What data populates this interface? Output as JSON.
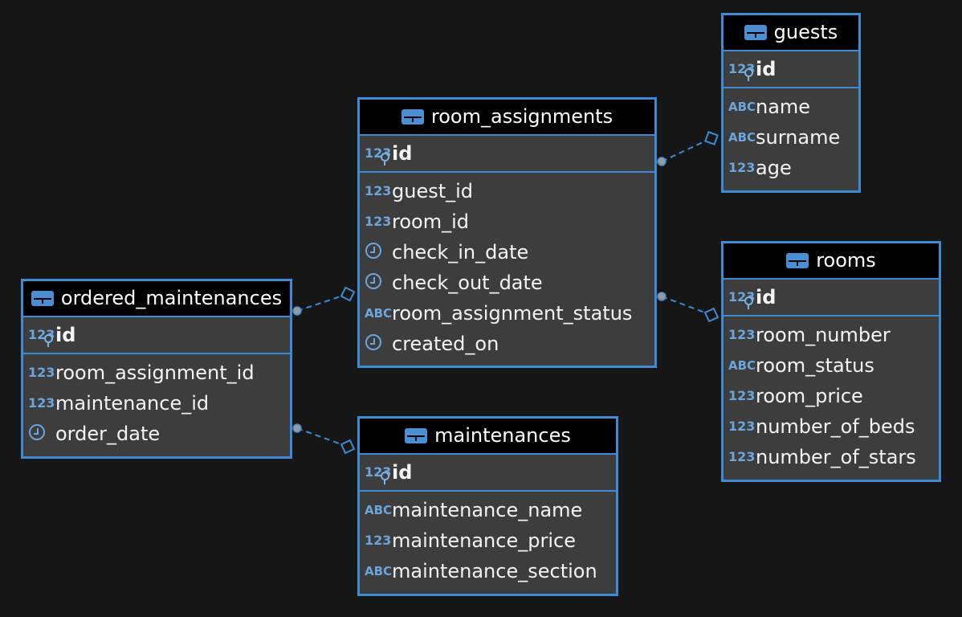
{
  "tables": [
    {
      "key": "room_assignments",
      "name": "room_assignments",
      "pk": {
        "name": "id",
        "type": "123"
      },
      "columns": [
        {
          "name": "guest_id",
          "type": "123"
        },
        {
          "name": "room_id",
          "type": "123"
        },
        {
          "name": "check_in_date",
          "type": "clock"
        },
        {
          "name": "check_out_date",
          "type": "clock"
        },
        {
          "name": "room_assignment_status",
          "type": "ABC"
        },
        {
          "name": "created_on",
          "type": "clock"
        }
      ]
    },
    {
      "key": "guests",
      "name": "guests",
      "pk": {
        "name": "id",
        "type": "123"
      },
      "columns": [
        {
          "name": "name",
          "type": "ABC"
        },
        {
          "name": "surname",
          "type": "ABC"
        },
        {
          "name": "age",
          "type": "123"
        }
      ]
    },
    {
      "key": "rooms",
      "name": "rooms",
      "pk": {
        "name": "id",
        "type": "123"
      },
      "columns": [
        {
          "name": "room_number",
          "type": "123"
        },
        {
          "name": "room_status",
          "type": "ABC"
        },
        {
          "name": "room_price",
          "type": "123"
        },
        {
          "name": "number_of_beds",
          "type": "123"
        },
        {
          "name": "number_of_stars",
          "type": "123"
        }
      ]
    },
    {
      "key": "ordered_maintenances",
      "name": "ordered_maintenances",
      "pk": {
        "name": "id",
        "type": "123"
      },
      "columns": [
        {
          "name": "room_assignment_id",
          "type": "123"
        },
        {
          "name": "maintenance_id",
          "type": "123"
        },
        {
          "name": "order_date",
          "type": "clock"
        }
      ]
    },
    {
      "key": "maintenances",
      "name": "maintenances",
      "pk": {
        "name": "id",
        "type": "123"
      },
      "columns": [
        {
          "name": "maintenance_name",
          "type": "ABC"
        },
        {
          "name": "maintenance_price",
          "type": "123"
        },
        {
          "name": "maintenance_section",
          "type": "ABC"
        }
      ]
    }
  ],
  "relations": [
    {
      "from": "room_assignments",
      "to": "guests"
    },
    {
      "from": "room_assignments",
      "to": "rooms"
    },
    {
      "from": "ordered_maintenances",
      "to": "room_assignments"
    },
    {
      "from": "ordered_maintenances",
      "to": "maintenances"
    }
  ],
  "colors": {
    "background": "#161617",
    "border": "#3d8bd5",
    "header": "#000000",
    "body": "#3d3d3d",
    "type_icon": "#6aa6dd",
    "text": "#f4f4f4"
  },
  "icons": {
    "table": "table-icon",
    "numeric": "numeric-type-icon",
    "text": "text-type-icon",
    "datetime": "clock-icon",
    "primary_key": "key-icon"
  }
}
